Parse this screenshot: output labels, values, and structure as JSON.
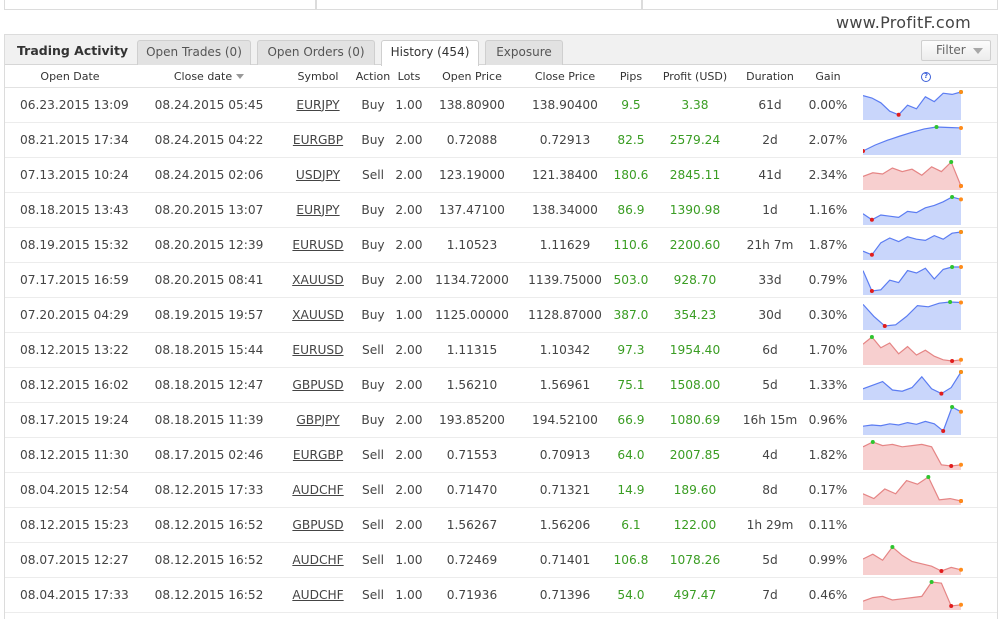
{
  "watermark": "www.ProfitF.com",
  "panel": {
    "title": "Trading Activity",
    "tabs": [
      {
        "label": "Open Trades (0)",
        "active": false
      },
      {
        "label": "Open Orders (0)",
        "active": false
      },
      {
        "label": "History (454)",
        "active": true
      },
      {
        "label": "Exposure",
        "active": false
      }
    ],
    "filter_label": "Filter"
  },
  "columns": [
    "Open Date",
    "Close date",
    "Symbol",
    "Action",
    "Lots",
    "Open Price",
    "Close Price",
    "Pips",
    "Profit (USD)",
    "Duration",
    "Gain"
  ],
  "colors": {
    "positive": "#3a9d23",
    "buy_fill": "#c9d6fb",
    "buy_line": "#5b7cf2",
    "sell_fill": "#f7cfcf",
    "sell_line": "#e58585",
    "max_marker": "#2ec52e",
    "min_marker": "#e11d1d",
    "last_marker": "#ff8c1a"
  },
  "rows": [
    {
      "open": "06.23.2015 13:09",
      "close": "08.24.2015 05:45",
      "symbol": "EURJPY",
      "action": "Buy",
      "lots": "1.00",
      "open_price": "138.80900",
      "close_price": "138.90400",
      "pips": "9.5",
      "profit": "3.38",
      "duration": "61d",
      "gain": "0.00%",
      "spark": [
        0.85,
        0.75,
        0.55,
        0.2,
        0.05,
        0.45,
        0.3,
        0.8,
        0.6,
        0.95,
        0.9,
        1.0
      ]
    },
    {
      "open": "08.21.2015 17:34",
      "close": "08.24.2015 04:22",
      "symbol": "EURGBP",
      "action": "Buy",
      "lots": "2.00",
      "open_price": "0.72088",
      "close_price": "0.72913",
      "pips": "82.5",
      "profit": "2579.24",
      "duration": "2d",
      "gain": "2.07%",
      "spark": [
        0.0,
        0.25,
        0.45,
        0.62,
        0.78,
        0.92,
        1.0,
        0.98,
        0.96
      ]
    },
    {
      "open": "07.13.2015 10:24",
      "close": "08.24.2015 02:06",
      "symbol": "USDJPY",
      "action": "Sell",
      "lots": "2.00",
      "open_price": "123.19000",
      "close_price": "121.38400",
      "pips": "180.6",
      "profit": "2845.11",
      "duration": "41d",
      "gain": "2.34%",
      "spark": [
        0.4,
        0.55,
        0.5,
        0.75,
        0.6,
        0.7,
        0.45,
        0.8,
        0.6,
        1.0,
        0.0
      ]
    },
    {
      "open": "08.18.2015 13:43",
      "close": "08.20.2015 13:07",
      "symbol": "EURJPY",
      "action": "Buy",
      "lots": "2.00",
      "open_price": "137.47100",
      "close_price": "138.34000",
      "pips": "86.9",
      "profit": "1390.98",
      "duration": "1d",
      "gain": "1.16%",
      "spark": [
        0.3,
        0.05,
        0.25,
        0.2,
        0.15,
        0.4,
        0.35,
        0.55,
        0.65,
        0.8,
        1.0,
        0.9
      ]
    },
    {
      "open": "08.19.2015 15:32",
      "close": "08.20.2015 12:39",
      "symbol": "EURUSD",
      "action": "Buy",
      "lots": "2.00",
      "open_price": "1.10523",
      "close_price": "1.11629",
      "pips": "110.6",
      "profit": "2200.60",
      "duration": "21h 7m",
      "gain": "1.87%",
      "spark": [
        0.2,
        0.05,
        0.55,
        0.75,
        0.6,
        0.8,
        0.7,
        0.65,
        0.85,
        0.7,
        0.95,
        1.0
      ]
    },
    {
      "open": "07.17.2015 16:59",
      "close": "08.20.2015 08:41",
      "symbol": "XAUUSD",
      "action": "Buy",
      "lots": "2.00",
      "open_price": "1134.72000",
      "close_price": "1139.75000",
      "pips": "503.0",
      "profit": "928.70",
      "duration": "33d",
      "gain": "0.79%",
      "spark": [
        0.85,
        0.0,
        0.05,
        0.45,
        0.35,
        0.85,
        0.75,
        0.95,
        0.5,
        0.9,
        1.0,
        1.0
      ]
    },
    {
      "open": "07.20.2015 04:29",
      "close": "08.19.2015 19:57",
      "symbol": "XAUUSD",
      "action": "Buy",
      "lots": "1.00",
      "open_price": "1125.00000",
      "close_price": "1128.87000",
      "pips": "387.0",
      "profit": "354.23",
      "duration": "30d",
      "gain": "0.30%",
      "spark": [
        0.9,
        0.4,
        0.0,
        0.05,
        0.4,
        0.85,
        0.8,
        0.95,
        1.0,
        0.98
      ]
    },
    {
      "open": "08.12.2015 13:22",
      "close": "08.18.2015 15:44",
      "symbol": "EURUSD",
      "action": "Sell",
      "lots": "2.00",
      "open_price": "1.11315",
      "close_price": "1.10342",
      "pips": "97.3",
      "profit": "1954.40",
      "duration": "6d",
      "gain": "1.70%",
      "spark": [
        0.7,
        1.0,
        0.55,
        0.75,
        0.3,
        0.6,
        0.25,
        0.45,
        0.2,
        0.05,
        0.0,
        0.05
      ]
    },
    {
      "open": "08.12.2015 16:02",
      "close": "08.18.2015 12:47",
      "symbol": "GBPUSD",
      "action": "Buy",
      "lots": "2.00",
      "open_price": "1.56210",
      "close_price": "1.56961",
      "pips": "75.1",
      "profit": "1508.00",
      "duration": "5d",
      "gain": "1.33%",
      "spark": [
        0.3,
        0.45,
        0.6,
        0.25,
        0.2,
        0.35,
        0.8,
        0.3,
        0.1,
        0.35,
        1.0
      ]
    },
    {
      "open": "08.17.2015 19:24",
      "close": "08.18.2015 11:39",
      "symbol": "GBPJPY",
      "action": "Buy",
      "lots": "2.00",
      "open_price": "193.85200",
      "close_price": "194.52100",
      "pips": "66.9",
      "profit": "1080.69",
      "duration": "16h 15m",
      "gain": "0.96%",
      "spark": [
        0.2,
        0.25,
        0.22,
        0.3,
        0.25,
        0.35,
        0.28,
        0.4,
        0.3,
        0.0,
        1.0,
        0.8
      ]
    },
    {
      "open": "08.12.2015 11:30",
      "close": "08.17.2015 02:46",
      "symbol": "EURGBP",
      "action": "Sell",
      "lots": "2.00",
      "open_price": "0.71553",
      "close_price": "0.70913",
      "pips": "64.0",
      "profit": "2007.85",
      "duration": "4d",
      "gain": "1.82%",
      "spark": [
        0.8,
        1.0,
        0.85,
        0.9,
        0.8,
        0.85,
        0.9,
        0.8,
        0.05,
        0.0,
        0.05
      ]
    },
    {
      "open": "08.04.2015 12:54",
      "close": "08.12.2015 17:33",
      "symbol": "AUDCHF",
      "action": "Sell",
      "lots": "2.00",
      "open_price": "0.71470",
      "close_price": "0.71321",
      "pips": "14.9",
      "profit": "189.60",
      "duration": "8d",
      "gain": "0.17%",
      "spark": [
        0.3,
        0.1,
        0.5,
        0.3,
        0.85,
        0.7,
        1.0,
        0.05,
        0.1,
        0.0
      ]
    },
    {
      "open": "08.12.2015 15:23",
      "close": "08.12.2015 16:52",
      "symbol": "GBPUSD",
      "action": "Sell",
      "lots": "2.00",
      "open_price": "1.56267",
      "close_price": "1.56206",
      "pips": "6.1",
      "profit": "122.00",
      "duration": "1h 29m",
      "gain": "0.11%",
      "spark": []
    },
    {
      "open": "08.07.2015 12:27",
      "close": "08.12.2015 16:52",
      "symbol": "AUDCHF",
      "action": "Sell",
      "lots": "1.00",
      "open_price": "0.72469",
      "close_price": "0.71401",
      "pips": "106.8",
      "profit": "1078.26",
      "duration": "5d",
      "gain": "0.99%",
      "spark": [
        0.5,
        0.7,
        0.45,
        1.0,
        0.65,
        0.4,
        0.3,
        0.2,
        0.0,
        0.15,
        0.05
      ]
    },
    {
      "open": "08.04.2015 17:33",
      "close": "08.12.2015 16:52",
      "symbol": "AUDCHF",
      "action": "Sell",
      "lots": "1.00",
      "open_price": "0.71936",
      "close_price": "0.71396",
      "pips": "54.0",
      "profit": "497.47",
      "duration": "7d",
      "gain": "0.46%",
      "spark": [
        0.2,
        0.35,
        0.4,
        0.25,
        0.3,
        0.35,
        0.4,
        1.0,
        0.95,
        0.0,
        0.05
      ]
    }
  ]
}
